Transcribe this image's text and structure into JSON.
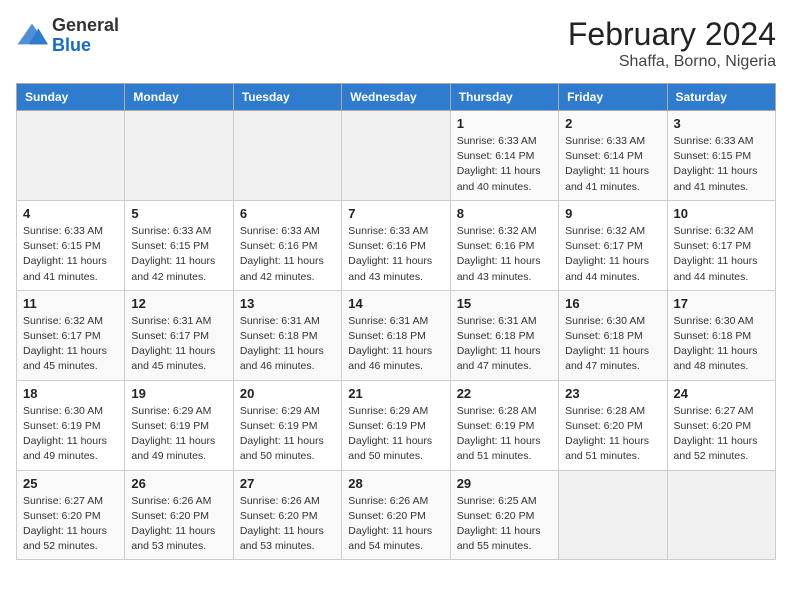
{
  "header": {
    "logo_general": "General",
    "logo_blue": "Blue",
    "title": "February 2024",
    "subtitle": "Shaffa, Borno, Nigeria"
  },
  "days_of_week": [
    "Sunday",
    "Monday",
    "Tuesday",
    "Wednesday",
    "Thursday",
    "Friday",
    "Saturday"
  ],
  "weeks": [
    [
      {
        "day": "",
        "info": ""
      },
      {
        "day": "",
        "info": ""
      },
      {
        "day": "",
        "info": ""
      },
      {
        "day": "",
        "info": ""
      },
      {
        "day": "1",
        "info": "Sunrise: 6:33 AM\nSunset: 6:14 PM\nDaylight: 11 hours and 40 minutes."
      },
      {
        "day": "2",
        "info": "Sunrise: 6:33 AM\nSunset: 6:14 PM\nDaylight: 11 hours and 41 minutes."
      },
      {
        "day": "3",
        "info": "Sunrise: 6:33 AM\nSunset: 6:15 PM\nDaylight: 11 hours and 41 minutes."
      }
    ],
    [
      {
        "day": "4",
        "info": "Sunrise: 6:33 AM\nSunset: 6:15 PM\nDaylight: 11 hours and 41 minutes."
      },
      {
        "day": "5",
        "info": "Sunrise: 6:33 AM\nSunset: 6:15 PM\nDaylight: 11 hours and 42 minutes."
      },
      {
        "day": "6",
        "info": "Sunrise: 6:33 AM\nSunset: 6:16 PM\nDaylight: 11 hours and 42 minutes."
      },
      {
        "day": "7",
        "info": "Sunrise: 6:33 AM\nSunset: 6:16 PM\nDaylight: 11 hours and 43 minutes."
      },
      {
        "day": "8",
        "info": "Sunrise: 6:32 AM\nSunset: 6:16 PM\nDaylight: 11 hours and 43 minutes."
      },
      {
        "day": "9",
        "info": "Sunrise: 6:32 AM\nSunset: 6:17 PM\nDaylight: 11 hours and 44 minutes."
      },
      {
        "day": "10",
        "info": "Sunrise: 6:32 AM\nSunset: 6:17 PM\nDaylight: 11 hours and 44 minutes."
      }
    ],
    [
      {
        "day": "11",
        "info": "Sunrise: 6:32 AM\nSunset: 6:17 PM\nDaylight: 11 hours and 45 minutes."
      },
      {
        "day": "12",
        "info": "Sunrise: 6:31 AM\nSunset: 6:17 PM\nDaylight: 11 hours and 45 minutes."
      },
      {
        "day": "13",
        "info": "Sunrise: 6:31 AM\nSunset: 6:18 PM\nDaylight: 11 hours and 46 minutes."
      },
      {
        "day": "14",
        "info": "Sunrise: 6:31 AM\nSunset: 6:18 PM\nDaylight: 11 hours and 46 minutes."
      },
      {
        "day": "15",
        "info": "Sunrise: 6:31 AM\nSunset: 6:18 PM\nDaylight: 11 hours and 47 minutes."
      },
      {
        "day": "16",
        "info": "Sunrise: 6:30 AM\nSunset: 6:18 PM\nDaylight: 11 hours and 47 minutes."
      },
      {
        "day": "17",
        "info": "Sunrise: 6:30 AM\nSunset: 6:18 PM\nDaylight: 11 hours and 48 minutes."
      }
    ],
    [
      {
        "day": "18",
        "info": "Sunrise: 6:30 AM\nSunset: 6:19 PM\nDaylight: 11 hours and 49 minutes."
      },
      {
        "day": "19",
        "info": "Sunrise: 6:29 AM\nSunset: 6:19 PM\nDaylight: 11 hours and 49 minutes."
      },
      {
        "day": "20",
        "info": "Sunrise: 6:29 AM\nSunset: 6:19 PM\nDaylight: 11 hours and 50 minutes."
      },
      {
        "day": "21",
        "info": "Sunrise: 6:29 AM\nSunset: 6:19 PM\nDaylight: 11 hours and 50 minutes."
      },
      {
        "day": "22",
        "info": "Sunrise: 6:28 AM\nSunset: 6:19 PM\nDaylight: 11 hours and 51 minutes."
      },
      {
        "day": "23",
        "info": "Sunrise: 6:28 AM\nSunset: 6:20 PM\nDaylight: 11 hours and 51 minutes."
      },
      {
        "day": "24",
        "info": "Sunrise: 6:27 AM\nSunset: 6:20 PM\nDaylight: 11 hours and 52 minutes."
      }
    ],
    [
      {
        "day": "25",
        "info": "Sunrise: 6:27 AM\nSunset: 6:20 PM\nDaylight: 11 hours and 52 minutes."
      },
      {
        "day": "26",
        "info": "Sunrise: 6:26 AM\nSunset: 6:20 PM\nDaylight: 11 hours and 53 minutes."
      },
      {
        "day": "27",
        "info": "Sunrise: 6:26 AM\nSunset: 6:20 PM\nDaylight: 11 hours and 53 minutes."
      },
      {
        "day": "28",
        "info": "Sunrise: 6:26 AM\nSunset: 6:20 PM\nDaylight: 11 hours and 54 minutes."
      },
      {
        "day": "29",
        "info": "Sunrise: 6:25 AM\nSunset: 6:20 PM\nDaylight: 11 hours and 55 minutes."
      },
      {
        "day": "",
        "info": ""
      },
      {
        "day": "",
        "info": ""
      }
    ]
  ]
}
